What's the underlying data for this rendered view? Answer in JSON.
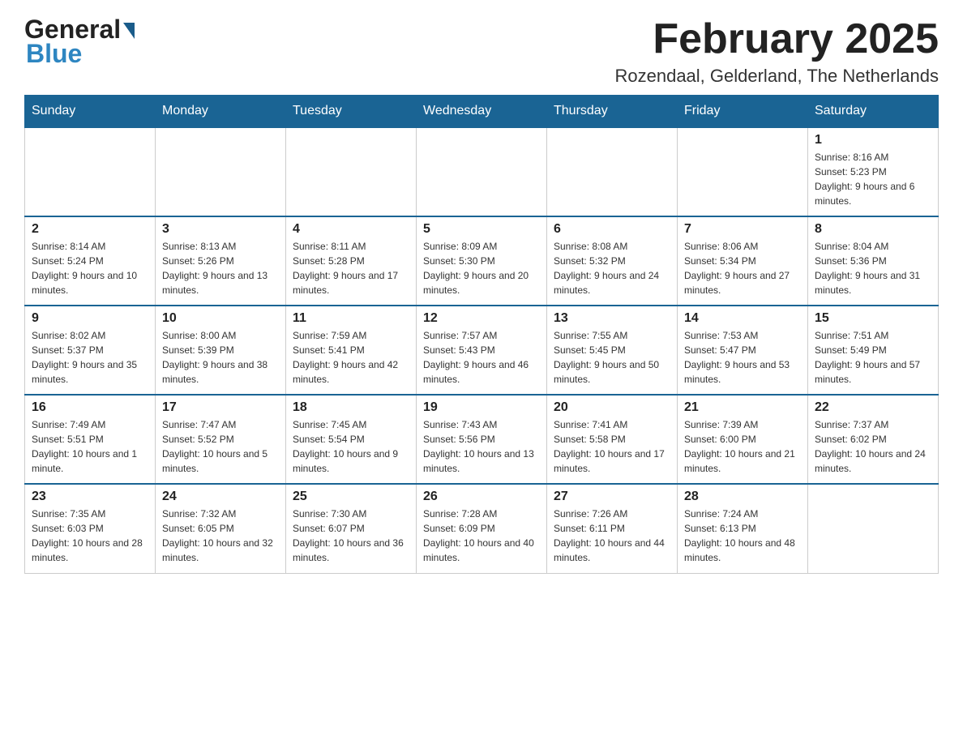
{
  "header": {
    "logo_general": "General",
    "logo_blue": "Blue",
    "month_title": "February 2025",
    "location": "Rozendaal, Gelderland, The Netherlands"
  },
  "days_of_week": [
    "Sunday",
    "Monday",
    "Tuesday",
    "Wednesday",
    "Thursday",
    "Friday",
    "Saturday"
  ],
  "weeks": [
    {
      "days": [
        {
          "number": "",
          "info": ""
        },
        {
          "number": "",
          "info": ""
        },
        {
          "number": "",
          "info": ""
        },
        {
          "number": "",
          "info": ""
        },
        {
          "number": "",
          "info": ""
        },
        {
          "number": "",
          "info": ""
        },
        {
          "number": "1",
          "info": "Sunrise: 8:16 AM\nSunset: 5:23 PM\nDaylight: 9 hours and 6 minutes."
        }
      ]
    },
    {
      "days": [
        {
          "number": "2",
          "info": "Sunrise: 8:14 AM\nSunset: 5:24 PM\nDaylight: 9 hours and 10 minutes."
        },
        {
          "number": "3",
          "info": "Sunrise: 8:13 AM\nSunset: 5:26 PM\nDaylight: 9 hours and 13 minutes."
        },
        {
          "number": "4",
          "info": "Sunrise: 8:11 AM\nSunset: 5:28 PM\nDaylight: 9 hours and 17 minutes."
        },
        {
          "number": "5",
          "info": "Sunrise: 8:09 AM\nSunset: 5:30 PM\nDaylight: 9 hours and 20 minutes."
        },
        {
          "number": "6",
          "info": "Sunrise: 8:08 AM\nSunset: 5:32 PM\nDaylight: 9 hours and 24 minutes."
        },
        {
          "number": "7",
          "info": "Sunrise: 8:06 AM\nSunset: 5:34 PM\nDaylight: 9 hours and 27 minutes."
        },
        {
          "number": "8",
          "info": "Sunrise: 8:04 AM\nSunset: 5:36 PM\nDaylight: 9 hours and 31 minutes."
        }
      ]
    },
    {
      "days": [
        {
          "number": "9",
          "info": "Sunrise: 8:02 AM\nSunset: 5:37 PM\nDaylight: 9 hours and 35 minutes."
        },
        {
          "number": "10",
          "info": "Sunrise: 8:00 AM\nSunset: 5:39 PM\nDaylight: 9 hours and 38 minutes."
        },
        {
          "number": "11",
          "info": "Sunrise: 7:59 AM\nSunset: 5:41 PM\nDaylight: 9 hours and 42 minutes."
        },
        {
          "number": "12",
          "info": "Sunrise: 7:57 AM\nSunset: 5:43 PM\nDaylight: 9 hours and 46 minutes."
        },
        {
          "number": "13",
          "info": "Sunrise: 7:55 AM\nSunset: 5:45 PM\nDaylight: 9 hours and 50 minutes."
        },
        {
          "number": "14",
          "info": "Sunrise: 7:53 AM\nSunset: 5:47 PM\nDaylight: 9 hours and 53 minutes."
        },
        {
          "number": "15",
          "info": "Sunrise: 7:51 AM\nSunset: 5:49 PM\nDaylight: 9 hours and 57 minutes."
        }
      ]
    },
    {
      "days": [
        {
          "number": "16",
          "info": "Sunrise: 7:49 AM\nSunset: 5:51 PM\nDaylight: 10 hours and 1 minute."
        },
        {
          "number": "17",
          "info": "Sunrise: 7:47 AM\nSunset: 5:52 PM\nDaylight: 10 hours and 5 minutes."
        },
        {
          "number": "18",
          "info": "Sunrise: 7:45 AM\nSunset: 5:54 PM\nDaylight: 10 hours and 9 minutes."
        },
        {
          "number": "19",
          "info": "Sunrise: 7:43 AM\nSunset: 5:56 PM\nDaylight: 10 hours and 13 minutes."
        },
        {
          "number": "20",
          "info": "Sunrise: 7:41 AM\nSunset: 5:58 PM\nDaylight: 10 hours and 17 minutes."
        },
        {
          "number": "21",
          "info": "Sunrise: 7:39 AM\nSunset: 6:00 PM\nDaylight: 10 hours and 21 minutes."
        },
        {
          "number": "22",
          "info": "Sunrise: 7:37 AM\nSunset: 6:02 PM\nDaylight: 10 hours and 24 minutes."
        }
      ]
    },
    {
      "days": [
        {
          "number": "23",
          "info": "Sunrise: 7:35 AM\nSunset: 6:03 PM\nDaylight: 10 hours and 28 minutes."
        },
        {
          "number": "24",
          "info": "Sunrise: 7:32 AM\nSunset: 6:05 PM\nDaylight: 10 hours and 32 minutes."
        },
        {
          "number": "25",
          "info": "Sunrise: 7:30 AM\nSunset: 6:07 PM\nDaylight: 10 hours and 36 minutes."
        },
        {
          "number": "26",
          "info": "Sunrise: 7:28 AM\nSunset: 6:09 PM\nDaylight: 10 hours and 40 minutes."
        },
        {
          "number": "27",
          "info": "Sunrise: 7:26 AM\nSunset: 6:11 PM\nDaylight: 10 hours and 44 minutes."
        },
        {
          "number": "28",
          "info": "Sunrise: 7:24 AM\nSunset: 6:13 PM\nDaylight: 10 hours and 48 minutes."
        },
        {
          "number": "",
          "info": ""
        }
      ]
    }
  ]
}
